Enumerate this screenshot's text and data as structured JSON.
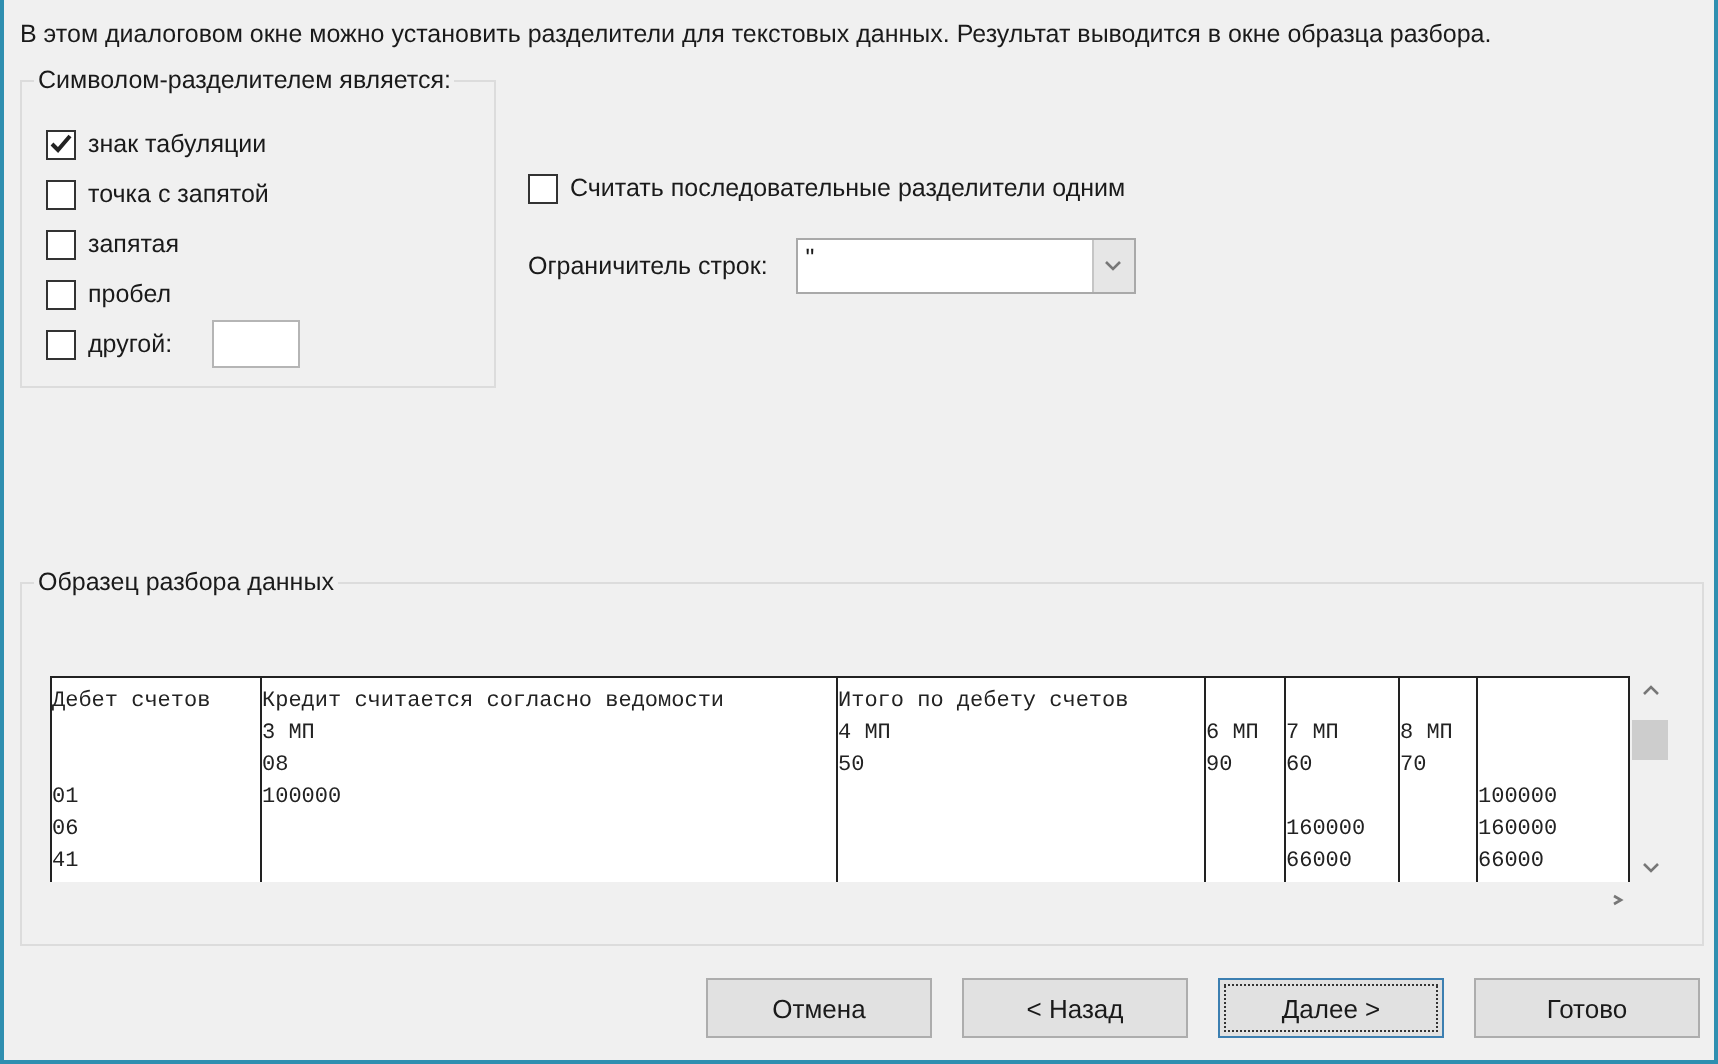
{
  "instruction": "В этом диалоговом окне можно установить разделители для текстовых данных. Результат выводится в окне образца разбора.",
  "delimiters": {
    "title": "Символом-разделителем является:",
    "options": [
      {
        "label": "знак табуляции",
        "checked": true
      },
      {
        "label": "точка с запятой",
        "checked": false
      },
      {
        "label": "запятая",
        "checked": false
      },
      {
        "label": "пробел",
        "checked": false
      },
      {
        "label": "другой:",
        "checked": false,
        "kind": "other"
      }
    ]
  },
  "treat_consecutive": {
    "label": "Считать последовательные разделители одним",
    "checked": false
  },
  "text_qualifier": {
    "label": "Ограничитель строк:",
    "value": "\""
  },
  "preview": {
    "title": "Образец разбора данных",
    "rows": [
      [
        "Дебет счетов",
        "Кредит считается согласно ведомости",
        "Итого по дебету счетов",
        null,
        null,
        null,
        null
      ],
      [
        null,
        "3 МП",
        "4 МП",
        "6 МП",
        "7 МП",
        "8 МП",
        null
      ],
      [
        null,
        "08",
        "50",
        "90",
        "60",
        "70",
        null
      ],
      [
        "01",
        "100000",
        null,
        null,
        null,
        null,
        "100000"
      ],
      [
        "06",
        null,
        null,
        null,
        "160000",
        null,
        "160000"
      ],
      [
        "41",
        null,
        null,
        null,
        "66000",
        null,
        "66000"
      ]
    ]
  },
  "buttons": [
    {
      "label": "Отмена",
      "focused": false
    },
    {
      "label": "< Назад",
      "focused": false
    },
    {
      "label": "Далее >",
      "focused": true
    },
    {
      "label": "Готово",
      "focused": false
    }
  ]
}
